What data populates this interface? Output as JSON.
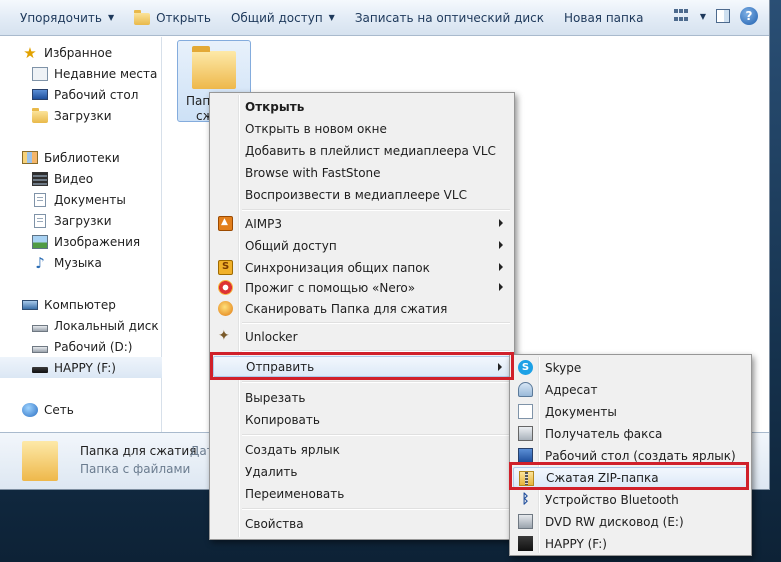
{
  "toolbar": {
    "organize": "Упорядочить",
    "open": "Открыть",
    "share": "Общий доступ",
    "burn": "Записать на оптический диск",
    "new_folder": "Новая папка",
    "help": "?"
  },
  "nav": {
    "favorites": "Избранное",
    "recent": "Недавние места",
    "desktop": "Рабочий стол",
    "downloads": "Загрузки",
    "libraries": "Библиотеки",
    "video": "Видео",
    "documents": "Документы",
    "lib_downloads": "Загрузки",
    "images": "Изображения",
    "music": "Музыка",
    "computer": "Компьютер",
    "local_disk": "Локальный диск (С",
    "desktop_d": "Рабочий (D:)",
    "happy": "HAPPY (F:)",
    "network": "Сеть"
  },
  "content": {
    "folder_label_line1": "Папк",
    "folder_label_line2": "сж"
  },
  "details": {
    "name": "Папка для сжатия",
    "date_label": "Дат",
    "type": "Папка с файлами"
  },
  "context_menu": {
    "open": "Открыть",
    "open_new_window": "Открыть в новом окне",
    "add_vlc_playlist": "Добавить в плейлист медиаплеера VLC",
    "browse_faststone": "Browse with FastStone",
    "play_vlc": "Воспроизвести в медиаплеере VLC",
    "aimp": "AIMP3",
    "share": "Общий доступ",
    "sync": "Синхронизация общих папок",
    "nero": "Прожиг с помощью «Nero»",
    "scan": "Сканировать Папка для сжатия",
    "unlocker": "Unlocker",
    "send_to": "Отправить",
    "cut": "Вырезать",
    "copy": "Копировать",
    "create_shortcut": "Создать ярлык",
    "delete": "Удалить",
    "rename": "Переименовать",
    "properties": "Свойства"
  },
  "send_to_menu": {
    "skype": "Skype",
    "recipient": "Адресат",
    "documents": "Документы",
    "fax": "Получатель факса",
    "desktop_shortcut": "Рабочий стол (создать ярлык)",
    "zip": "Сжатая ZIP-папка",
    "bluetooth": "Устройство Bluetooth",
    "dvd": "DVD RW дисковод (E:)",
    "happy": "HAPPY (F:)"
  },
  "colors": {
    "highlight_box": "#d0202a"
  }
}
